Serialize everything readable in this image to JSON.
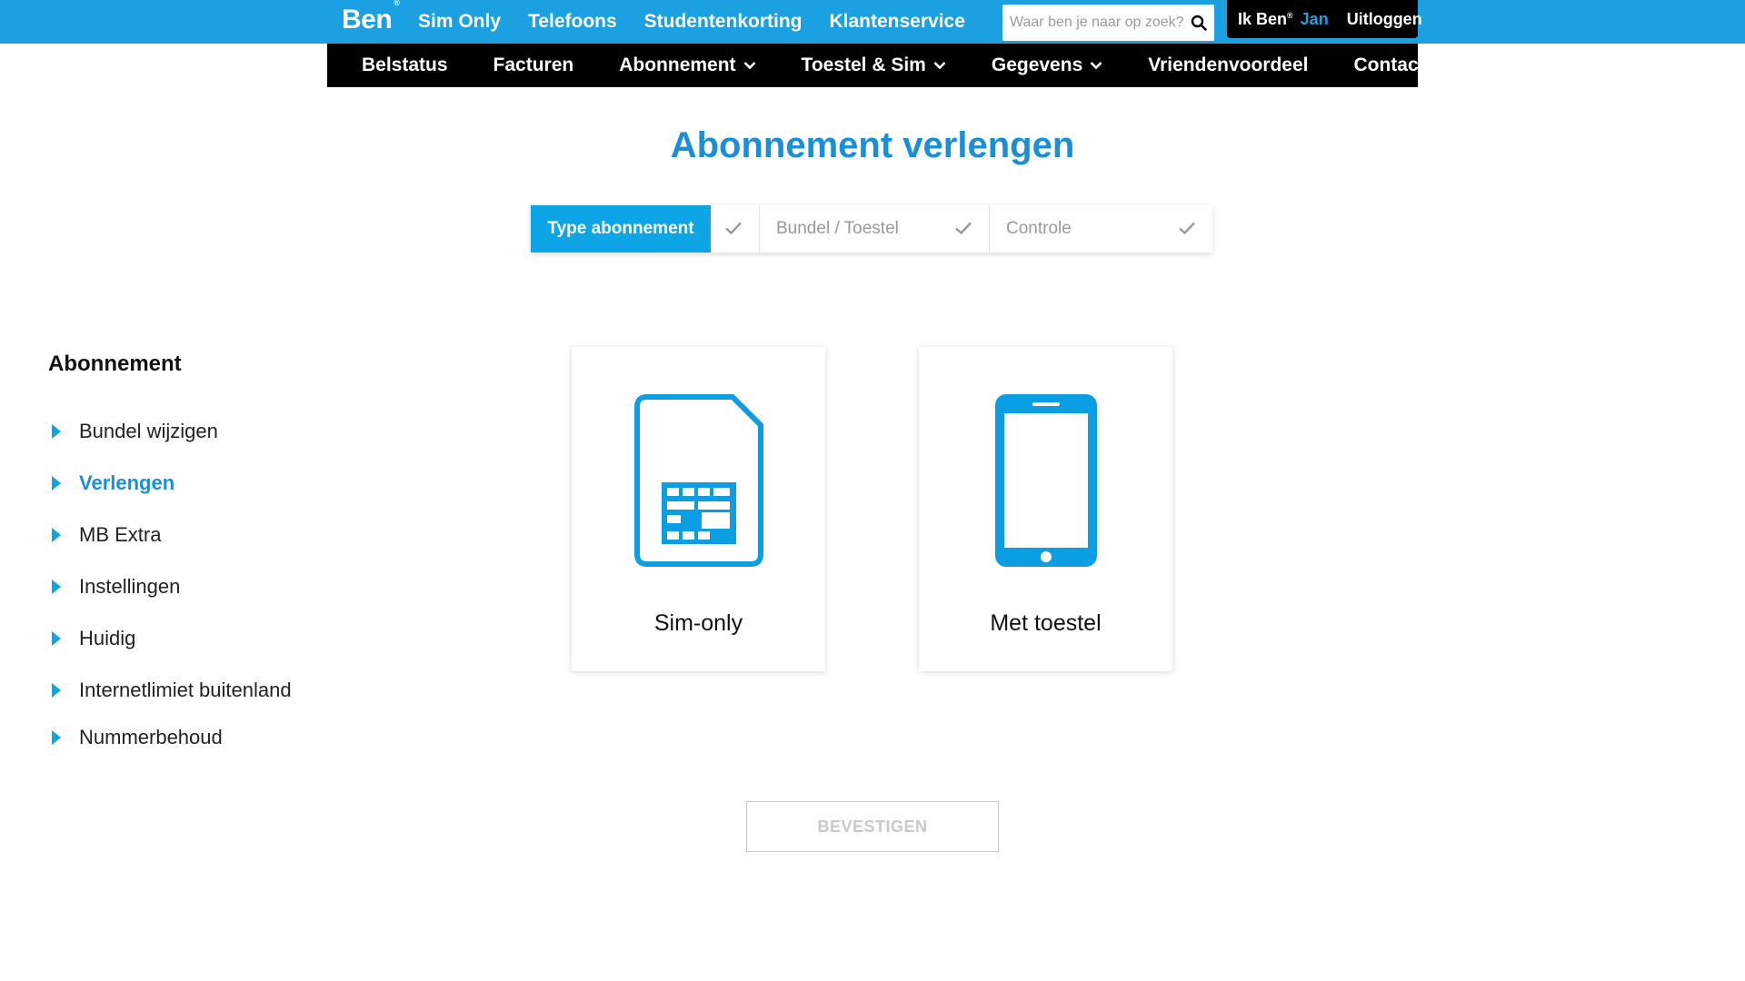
{
  "header": {
    "logo": "Ben",
    "logo_mark": "®",
    "nav": [
      "Sim Only",
      "Telefoons",
      "Studentenkorting",
      "Klantenservice"
    ],
    "search_placeholder": "Waar ben je naar op zoek?",
    "user": {
      "prefix": "Ik Ben",
      "prefix_mark": "®",
      "name": "Jan",
      "logout": "Uitloggen"
    }
  },
  "subnav": {
    "items": [
      {
        "label": "Belstatus",
        "dropdown": false
      },
      {
        "label": "Facturen",
        "dropdown": false
      },
      {
        "label": "Abonnement",
        "dropdown": true
      },
      {
        "label": "Toestel & Sim",
        "dropdown": true
      },
      {
        "label": "Gegevens",
        "dropdown": true
      },
      {
        "label": "Vriendenvoordeel",
        "dropdown": false
      },
      {
        "label": "Contact",
        "dropdown": false
      }
    ]
  },
  "page_title": "Abonnement verlengen",
  "steps": [
    {
      "label": "Type abonnement",
      "active": true
    },
    {
      "label": "Bundel / Toestel",
      "active": false
    },
    {
      "label": "Controle",
      "active": false
    }
  ],
  "sidebar": {
    "title": "Abonnement",
    "items": [
      {
        "label": "Bundel wijzigen",
        "active": false
      },
      {
        "label": "Verlengen",
        "active": true
      },
      {
        "label": "MB Extra",
        "active": false
      },
      {
        "label": "Instellingen",
        "active": false
      },
      {
        "label": "Huidig",
        "active": false
      },
      {
        "label": "Internetlimiet buitenland",
        "active": false
      },
      {
        "label": "Nummerbehoud",
        "active": false
      }
    ]
  },
  "options": [
    {
      "label": "Sim-only",
      "icon": "sim-card-icon"
    },
    {
      "label": "Met toestel",
      "icon": "smartphone-icon"
    }
  ],
  "confirm_label": "BEVESTIGEN",
  "colors": {
    "brand_blue": "#1ba1e2",
    "title_blue": "#1b8fd6",
    "active_step": "#0ea5e6",
    "icon_blue": "#0b9ee3",
    "nav_black": "#000000"
  }
}
